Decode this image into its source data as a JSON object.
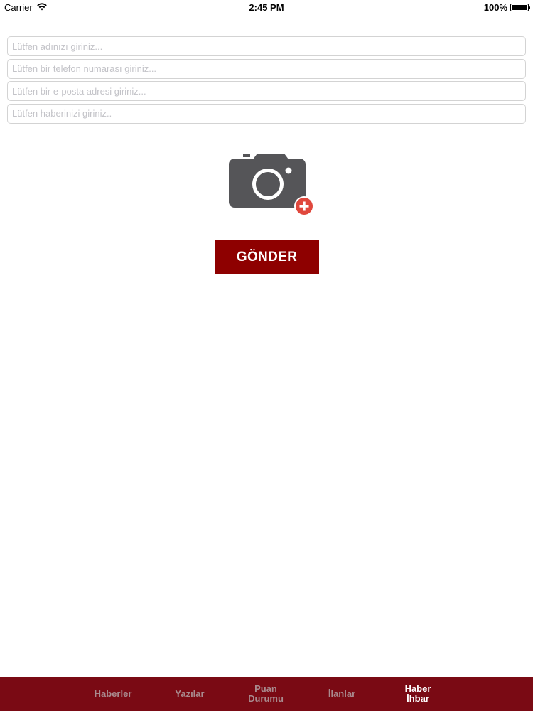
{
  "status_bar": {
    "carrier": "Carrier",
    "time": "2:45 PM",
    "battery": "100%",
    "battery_level": 1.0
  },
  "form": {
    "name_placeholder": "Lütfen adınızı giriniz...",
    "phone_placeholder": "Lütfen bir telefon numarası giriniz...",
    "email_placeholder": "Lütfen bir e-posta adresi giriniz...",
    "news_placeholder": "Lütfen haberinizi giriniz..",
    "name_value": "",
    "phone_value": "",
    "email_value": "",
    "news_value": ""
  },
  "photo": {
    "icon": "camera-add-icon"
  },
  "submit": {
    "label": "GÖNDER"
  },
  "tabs": [
    {
      "label": "Haberler",
      "active": false
    },
    {
      "label": "Yazılar",
      "active": false
    },
    {
      "label": "Puan\nDurumu",
      "active": false
    },
    {
      "label": "İlanlar",
      "active": false
    },
    {
      "label": "Haber\nİhbar",
      "active": true
    }
  ],
  "colors": {
    "accent": "#8e0000",
    "tab_bar": "#7a0a14",
    "tab_inactive": "#a98a8e",
    "tab_active": "#ffffff",
    "camera": "#555558",
    "plus_badge": "#e0483d"
  }
}
